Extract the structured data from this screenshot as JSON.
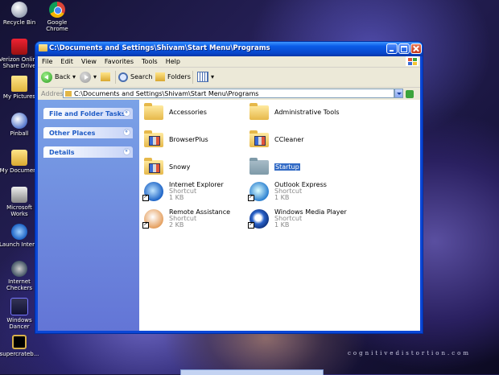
{
  "desktop": {
    "icons": [
      {
        "label": "Recycle Bin",
        "icon": "recycle-bin-icon"
      },
      {
        "label": "Google Chrome",
        "icon": "chrome-icon"
      },
      {
        "label": "Verizon Online Share Drive",
        "icon": "verizon-icon"
      },
      {
        "label": "My Pictures",
        "icon": "folder-icon"
      },
      {
        "label": "Pinball",
        "icon": "pinball-icon"
      },
      {
        "label": "My Document",
        "icon": "documents-icon"
      },
      {
        "label": "Microsoft Works",
        "icon": "works-icon"
      },
      {
        "label": "Launch Inter...",
        "icon": "ie-icon"
      },
      {
        "label": "Internet Checkers",
        "icon": "checkers-icon"
      },
      {
        "label": "Windows Dancer",
        "icon": "dancer-icon"
      },
      {
        "label": "supercrateb...",
        "icon": "crate-icon"
      }
    ],
    "watermark": "cognitivedistortion.com"
  },
  "window": {
    "title": "C:\\Documents and Settings\\Shivam\\Start Menu\\Programs",
    "menu": [
      "File",
      "Edit",
      "View",
      "Favorites",
      "Tools",
      "Help"
    ],
    "toolbar": {
      "back": "Back",
      "search": "Search",
      "folders": "Folders"
    },
    "address": {
      "label": "Address",
      "value": "C:\\Documents and Settings\\Shivam\\Start Menu\\Programs",
      "go": "Go"
    },
    "tasks": [
      "File and Folder Tasks",
      "Other Places",
      "Details"
    ],
    "items": [
      {
        "name": "Accessories",
        "type": "folder"
      },
      {
        "name": "Administrative Tools",
        "type": "folder"
      },
      {
        "name": "BrowserPlus",
        "type": "program-folder"
      },
      {
        "name": "CCleaner",
        "type": "program-folder"
      },
      {
        "name": "Snowy",
        "type": "program-folder"
      },
      {
        "name": "Startup",
        "type": "folder-selected"
      },
      {
        "name": "Internet Explorer",
        "kind": "Shortcut",
        "size": "1 KB"
      },
      {
        "name": "Outlook Express",
        "kind": "Shortcut",
        "size": "1 KB"
      },
      {
        "name": "Remote Assistance",
        "kind": "Shortcut",
        "size": "2 KB"
      },
      {
        "name": "Windows Media Player",
        "kind": "Shortcut",
        "size": "1 KB"
      }
    ]
  }
}
